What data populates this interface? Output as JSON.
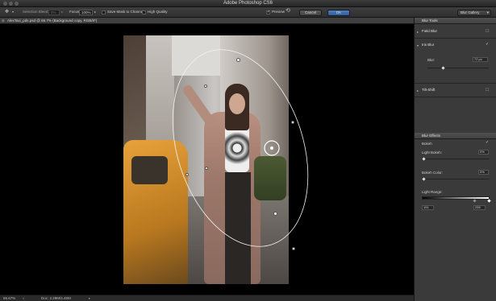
{
  "window": {
    "title": "Adobe Photoshop CS6"
  },
  "options_bar": {
    "selection_bleed_label": "Selection Bleed:",
    "selection_bleed_value": "0%",
    "focus_label": "Focus:",
    "focus_value": "100%",
    "save_mask_label": "Save Mask to Channels",
    "save_mask_checked": false,
    "high_quality_label": "High Quality",
    "high_quality_checked": false,
    "preview_label": "Preview",
    "preview_checked": true,
    "cancel_label": "Cancel",
    "ok_label": "OK",
    "workspace_selected": "Blur Gallery"
  },
  "document_tab": {
    "label": "AlexTaxi_pds.psd @ 66.7% (Background copy, RGB/8*)"
  },
  "status_bar": {
    "zoom": "66.67%",
    "doc_size": "Doc: 2.29M/4.45M"
  },
  "blur_tools": {
    "header": "Blur Tools",
    "field_blur": "Field Blur",
    "iris_blur": "Iris Blur",
    "iris_blur_enabled": true,
    "blur_label": "Blur:",
    "blur_value": "72 px",
    "blur_level": 0.25,
    "tilt_shift": "Tilt-Shift"
  },
  "blur_effects": {
    "header": "Blur Effects",
    "bokeh_label": "Bokeh",
    "bokeh_enabled": true,
    "light_bokeh_label": "Light Bokeh:",
    "light_bokeh_value": "0%",
    "bokeh_color_label": "Bokeh Color:",
    "bokeh_color_value": "0%",
    "light_range_label": "Light Range:",
    "light_range_low": "191",
    "light_range_high": "255"
  },
  "icons": {
    "move": "move-tool-icon",
    "reset": "reset-icon",
    "checkmark": "checkmark-icon"
  }
}
